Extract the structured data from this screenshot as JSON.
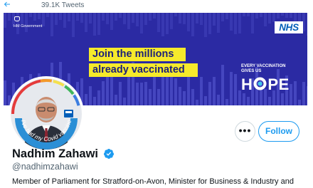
{
  "header": {
    "back_icon": "arrow-left-icon",
    "tweet_count": "39.1K Tweets"
  },
  "banner": {
    "gov_label": "HM Government",
    "nhs_logo": "NHS",
    "headline_line1": "Join the millions",
    "headline_line2": "already vaccinated",
    "tagline": "EVERY VACCINATION\nGIVES US",
    "hope_before": "H",
    "hope_after": "PE",
    "colors": {
      "background": "#2b2aa3",
      "highlight": "#f6ea2b",
      "headline_text": "#1b1f7a",
      "nhs_blue": "#005eb8"
    }
  },
  "profile": {
    "avatar_badge_text": "I've had my Covid vaccine",
    "more_button_label": "•••",
    "follow_button_label": "Follow",
    "display_name": "Nadhim Zahawi",
    "verified_icon": "verified-badge-icon",
    "handle": "@nadhimzahawi",
    "bio": "Member of Parliament for Stratford-on-Avon, Minister for Business & Industry and"
  },
  "colors": {
    "accent": "#1d9bf0",
    "muted_text": "#536471",
    "text": "#0f1419"
  }
}
